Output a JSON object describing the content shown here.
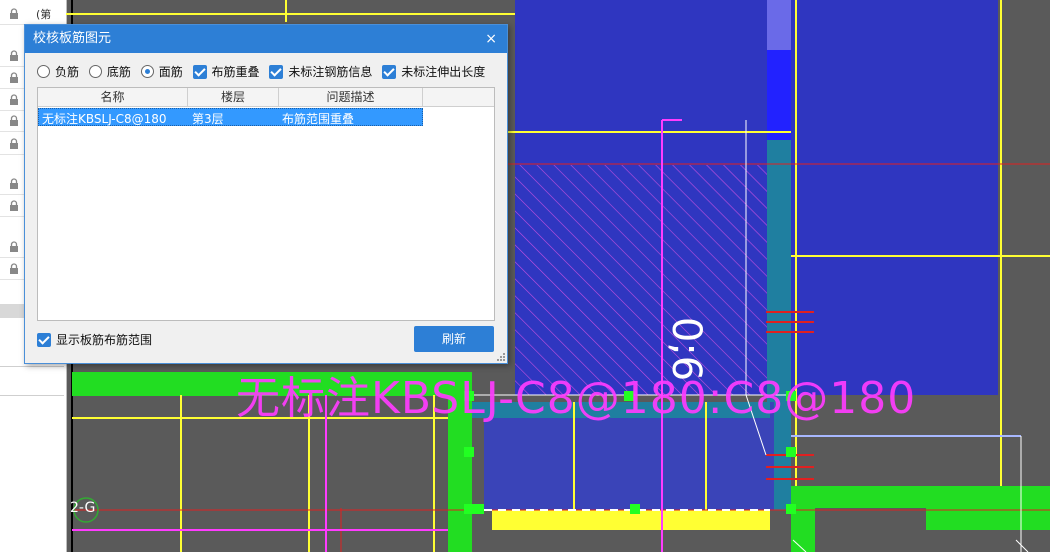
{
  "left_panel": {
    "first_row_text": "(第",
    "lock_rows": [
      8,
      50,
      72,
      94,
      115,
      138,
      178,
      200,
      241,
      263
    ]
  },
  "cad": {
    "rebar_label": "无标注KBSLJ-C8@180:C8@180",
    "dimension_label": "0;6",
    "axis_label": "2-G"
  },
  "dialog": {
    "title": "校核板筋图元",
    "close_icon": "×",
    "options": {
      "radio_negative": "负筋",
      "radio_bottom": "底筋",
      "radio_top": "面筋",
      "chk_overlap": "布筋重叠",
      "chk_unlabeled_info": "未标注钢筋信息",
      "chk_unlabeled_extension": "未标注伸出长度"
    },
    "table": {
      "headers": [
        "名称",
        "楼层",
        "问题描述"
      ],
      "rows": [
        {
          "name": "无标注KBSLJ-C8@180",
          "floor": "第3层",
          "issue": "布筋范围重叠"
        }
      ]
    },
    "show_range_label": "显示板筋布筋范围",
    "refresh_label": "刷新"
  },
  "colors": {
    "accent": "#2d7fd6",
    "cad_bg": "#5a5a5a",
    "slab_blue": "#2f36c0",
    "beam_green": "#22dd22",
    "rebar_magenta": "#ff3cff",
    "axis_yellow": "#ffff33"
  }
}
